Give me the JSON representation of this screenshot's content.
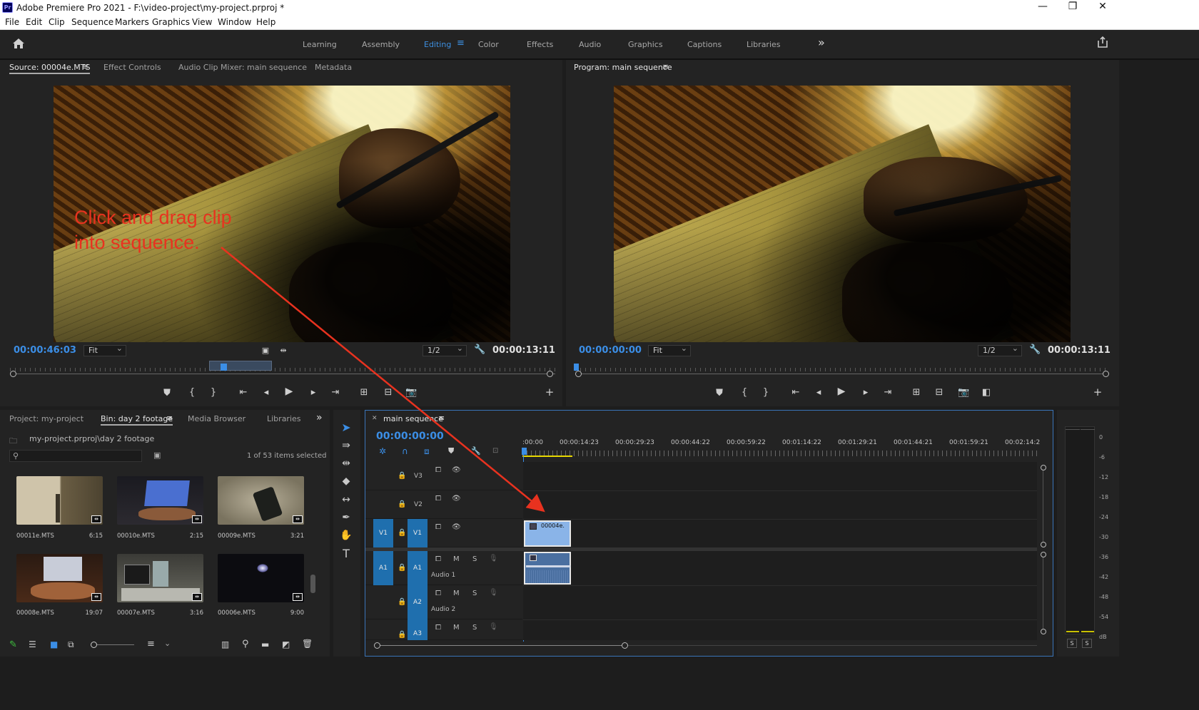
{
  "app": {
    "title": "Adobe Premiere Pro 2021 - F:\\video-project\\my-project.prproj *",
    "logo_text": "Pr"
  },
  "window_controls": {
    "minimize": "—",
    "restore": "❐",
    "close": "✕"
  },
  "menu": [
    "File",
    "Edit",
    "Clip",
    "Sequence",
    "Markers",
    "Graphics",
    "View",
    "Window",
    "Help"
  ],
  "workspaces": {
    "items": [
      "Learning",
      "Assembly",
      "Editing",
      "Color",
      "Effects",
      "Audio",
      "Graphics",
      "Captions",
      "Libraries"
    ],
    "active": "Editing",
    "overflow": "»"
  },
  "source_monitor": {
    "tabs": [
      "Source: 00004e.MTS",
      "Effect Controls",
      "Audio Clip Mixer: main sequence",
      "Metadata"
    ],
    "timecode_in": "00:00:46:03",
    "zoom": "Fit",
    "resolution": "1/2",
    "duration": "00:00:13:11",
    "annotation_line1": "Click and drag clip",
    "annotation_line2": "into sequence."
  },
  "program_monitor": {
    "title": "Program: main sequence",
    "timecode": "00:00:00:00",
    "zoom": "Fit",
    "resolution": "1/2",
    "duration": "00:00:13:11"
  },
  "project_panel": {
    "tabs": [
      "Project: my-project",
      "Bin: day 2 footage",
      "Media Browser",
      "Libraries"
    ],
    "active_tab": "Bin: day 2 footage",
    "path": "my-project.prproj\\day 2 footage",
    "selection_status": "1 of 53 items selected",
    "clips": [
      {
        "name": "00011e.MTS",
        "duration": "6:15"
      },
      {
        "name": "00010e.MTS",
        "duration": "2:15"
      },
      {
        "name": "00009e.MTS",
        "duration": "3:21"
      },
      {
        "name": "00008e.MTS",
        "duration": "19:07"
      },
      {
        "name": "00007e.MTS",
        "duration": "3:16"
      },
      {
        "name": "00006e.MTS",
        "duration": "9:00"
      }
    ]
  },
  "timeline": {
    "title": "main sequence",
    "timecode": "00:00:00:00",
    "ruler": [
      ":00:00",
      "00:00:14:23",
      "00:00:29:23",
      "00:00:44:22",
      "00:00:59:22",
      "00:01:14:22",
      "00:01:29:21",
      "00:01:44:21",
      "00:01:59:21",
      "00:02:14:2"
    ],
    "tracks": {
      "v3": "V3",
      "v2": "V2",
      "v1": "V1",
      "v1_source": "V1",
      "a1": "A1",
      "a1_source": "A1",
      "a2": "A2",
      "a3": "A3",
      "audio1_name": "Audio 1",
      "audio2_name": "Audio 2"
    },
    "clip_label": "00004e.",
    "mute": "M",
    "solo": "S"
  },
  "audio_meter": {
    "scale": [
      "0",
      "-6",
      "-12",
      "-18",
      "-24",
      "-30",
      "-36",
      "-42",
      "-48",
      "-54",
      "dB"
    ],
    "solo_left": "S",
    "solo_right": "S"
  },
  "colors": {
    "accent_blue": "#3b8ee6",
    "track_blue": "#1f6fae",
    "video_clip": "#8ab4e8",
    "audio_clip": "#4a6fa0",
    "annotation_red": "#e8321f"
  }
}
